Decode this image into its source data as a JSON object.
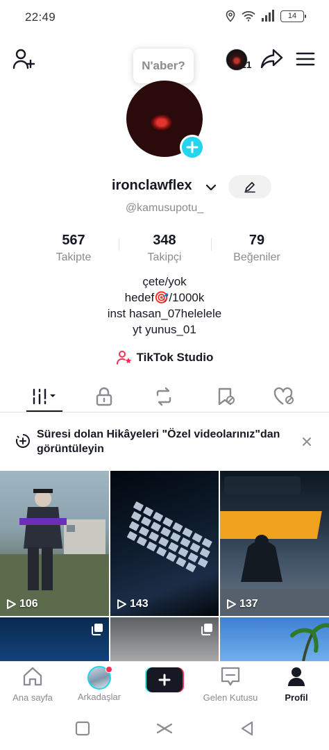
{
  "status_bar": {
    "time": "22:49",
    "battery": "14"
  },
  "tooltip": {
    "text": "N'aber?"
  },
  "top_nav": {
    "notification_count": "21"
  },
  "profile": {
    "username": "ironclawflex",
    "handle": "@kamusupotu_",
    "stats": [
      {
        "value": "567",
        "label": "Takipte"
      },
      {
        "value": "348",
        "label": "Takipçi"
      },
      {
        "value": "79",
        "label": "Beğeniler"
      }
    ],
    "bio": {
      "line1": "çete/yok",
      "line2": "hedef🎯/1000k",
      "line3": "inst hasan_07helelele",
      "line4": "yt yunus_01"
    },
    "studio_label": "TikTok Studio"
  },
  "banner": {
    "text": "Süresi dolan Hikâyeleri \"Özel videolarınız\"dan görüntüleyin"
  },
  "videos": [
    {
      "views": "106"
    },
    {
      "views": "143"
    },
    {
      "views": "137"
    }
  ],
  "bottom_nav": {
    "home": "Ana sayfa",
    "friends": "Arkadaşlar",
    "inbox": "Gelen Kutusu",
    "profile": "Profil"
  },
  "colors": {
    "accent_cyan": "#20d5ec",
    "accent_red": "#fe2c55",
    "text_primary": "#161823",
    "text_secondary": "#8a8b91"
  }
}
